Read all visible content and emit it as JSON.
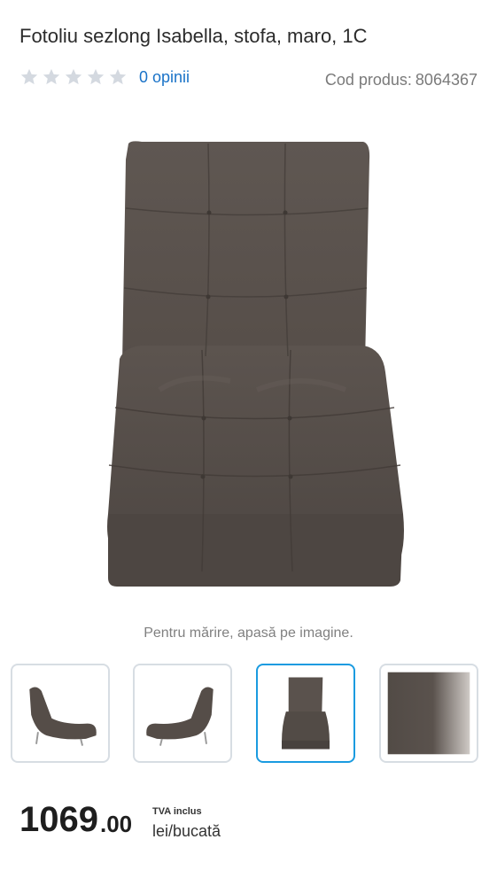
{
  "product": {
    "title": "Fotoliu sezlong Isabella, stofa, maro, 1C",
    "rating": 0,
    "reviews_text": "0 opinii",
    "code_label": "Cod produs:",
    "code_value": "8064367"
  },
  "gallery": {
    "hint": "Pentru mărire, apasă pe imagine.",
    "thumbnails": [
      {
        "name": "thumb-chaise-side-left",
        "active": false
      },
      {
        "name": "thumb-chaise-side-right",
        "active": false
      },
      {
        "name": "thumb-chaise-front",
        "active": true
      },
      {
        "name": "thumb-fabric-swatch",
        "active": false
      }
    ]
  },
  "price": {
    "integer": "1069",
    "decimal": ".00",
    "vat_label": "TVA inclus",
    "unit": "lei/bucată"
  },
  "colors": {
    "accent": "#1a9be0",
    "link": "#1a73c8",
    "fabric": "#5a524d",
    "star_empty": "#d4d9e0"
  }
}
